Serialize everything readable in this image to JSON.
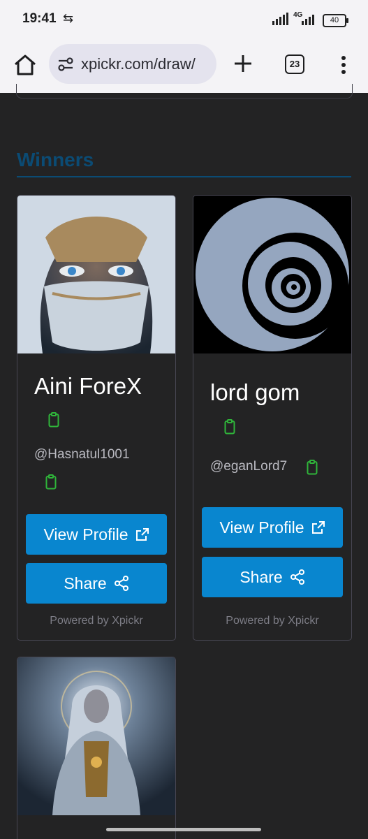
{
  "status_bar": {
    "time": "19:41",
    "sync_icon": "sync-icon",
    "network": "4G",
    "battery": "40"
  },
  "browser": {
    "url": "xpickr.com/draw/",
    "tab_count": "23"
  },
  "section": {
    "title": "Winners"
  },
  "cards": [
    {
      "name": "Aini ForeX",
      "handle": "@Hasnatul1001",
      "view_label": "View Profile",
      "share_label": "Share",
      "powered": "Powered by Xpickr"
    },
    {
      "name": "lord gom",
      "handle": "@eganLord7",
      "view_label": "View Profile",
      "share_label": "Share",
      "powered": "Powered by Xpickr"
    }
  ],
  "colors": {
    "accent": "#0986cf",
    "title": "#0b4b74",
    "clipboard": "#2fb53a",
    "background": "#232324"
  }
}
